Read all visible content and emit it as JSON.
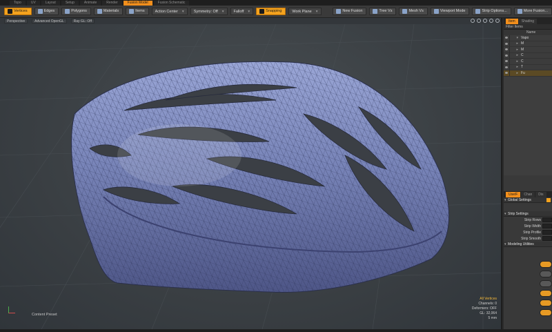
{
  "top_tabs": [
    {
      "label": "Topo",
      "active": false
    },
    {
      "label": "UV",
      "active": false
    },
    {
      "label": "Layout",
      "active": false
    },
    {
      "label": "Setup",
      "active": false
    },
    {
      "label": "Animate",
      "active": false
    },
    {
      "label": "Render",
      "active": false
    },
    {
      "label": "Fusion Model",
      "active": true
    },
    {
      "label": "Fusion Schematic",
      "active": false
    }
  ],
  "toolbar": {
    "vertices": "Vertices",
    "edges": "Edges",
    "polygons": "Polygons",
    "materials": "Materials",
    "items": "Items",
    "action_center": "Action Center",
    "symmetry": "Symmetry: Off",
    "falloff": "Falloff",
    "snapping": "Snapping",
    "work_plane": "Work Plane",
    "new_fusion": "New Fusion",
    "tree_vis": "Tree Vs",
    "mesh_vis": "Mesh Vs",
    "viewport_mode": "Viewport Mode",
    "strip_options": "Strip Options...",
    "more_fusion": "More Fusion..."
  },
  "viewport": {
    "view": "Perspective",
    "shading": "Advanced OpenGL",
    "raygl": "Ray GL: Off",
    "content_preset": "Content Preset",
    "stats": {
      "selection": "All Vertices",
      "channels": "Channels: 0",
      "deformers": "Deformers: OFF",
      "gl": "GL: 32,064",
      "distance": "5 mm"
    }
  },
  "right_panel": {
    "tabs": [
      "Item",
      "Shading"
    ],
    "filter": "Filter Items",
    "list_header": "Name",
    "rows": [
      {
        "label": "Vapo",
        "arrow": "▾"
      },
      {
        "label": "M",
        "arrow": "▸"
      },
      {
        "label": "M",
        "arrow": "▸"
      },
      {
        "label": "C",
        "arrow": "▸"
      },
      {
        "label": "C",
        "arrow": "▸"
      },
      {
        "label": "T",
        "arrow": "▸"
      },
      {
        "label": "Fu",
        "arrow": "▸"
      }
    ],
    "props_tabs": [
      "Use/F",
      "Chan",
      "Dis"
    ],
    "global_settings": "Global Settings",
    "strip_settings": "Strip Settings",
    "fields": [
      "Strip Rows",
      "Strip Width",
      "Strip Profile",
      "Strip Smooth"
    ],
    "modeling_utilities": "Modeling Utilities"
  },
  "colors": {
    "accent": "#f5a31e",
    "viewport_bg": "#3b4044",
    "mesh": "#7c86b4"
  }
}
